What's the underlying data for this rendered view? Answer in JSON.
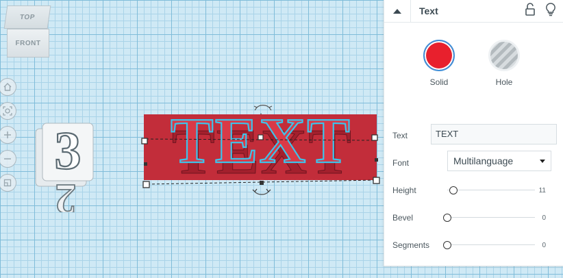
{
  "viewcube": {
    "top_label": "TOP",
    "front_label": "FRONT"
  },
  "nav": {
    "icons": [
      "home-icon",
      "fit-view-icon",
      "zoom-in-icon",
      "zoom-out-icon",
      "perspective-icon"
    ]
  },
  "panel": {
    "title": "Text",
    "solid_label": "Solid",
    "hole_label": "Hole",
    "solid_color": "#e8202d",
    "text_label": "Text",
    "text_value": "TEXT",
    "font_label": "Font",
    "font_value": "Multilanguage",
    "height_label": "Height",
    "height_value": "11",
    "bevel_label": "Bevel",
    "bevel_value": "0",
    "segments_label": "Segments",
    "segments_value": "0"
  },
  "workplane": {
    "shape_text": "TEXT",
    "three_glyph": "3",
    "two_glyph": "2",
    "text_color": "#cf3b47",
    "outline_color": "#3ec3ea"
  }
}
